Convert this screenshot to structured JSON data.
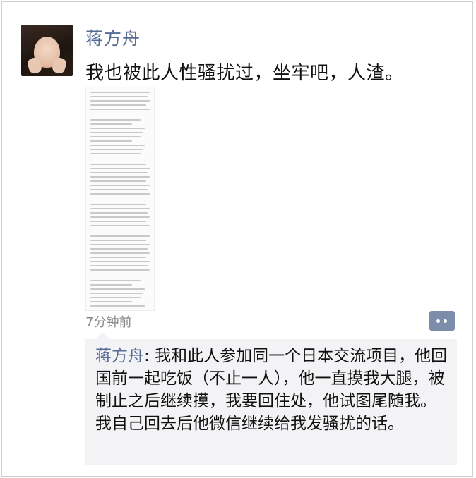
{
  "post": {
    "author": "蒋方舟",
    "text": "我也被此人性骚扰过，坐牢吧，人渣。",
    "timestamp": "7分钟前"
  },
  "comments": [
    {
      "author": "蒋方舟",
      "separator": ": ",
      "text": "我和此人参加同一个日本交流项目，他回国前一起吃饭（不止一人），他一直摸我大腿，被制止之后继续摸，我要回住处，他试图尾随我。我自己回去后他微信继续给我发骚扰的话。"
    }
  ],
  "icons": {
    "avatar": "avatar-image",
    "comment": "comment-bubble-icon"
  },
  "colors": {
    "name_link": "#576b95",
    "comment_bg": "#f3f3f5"
  }
}
